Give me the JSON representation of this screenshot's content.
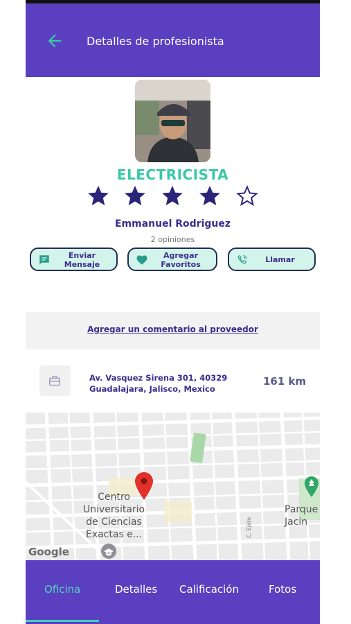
{
  "appbar": {
    "title": "Detalles de profesionista",
    "back_icon": "arrow-left-icon"
  },
  "profile": {
    "category": "ELECTRICISTA",
    "rating": 4,
    "max_rating": 5,
    "name": "Emmanuel Rodriguez",
    "opinions": "2 opiniones"
  },
  "actions": {
    "message": {
      "line1": "Enviar",
      "line2": "Mensaje",
      "icon": "message-icon"
    },
    "favorite": {
      "line1": "Agregar",
      "line2": "Favoritos",
      "icon": "heart-icon"
    },
    "call": {
      "label": "Llamar",
      "icon": "phone-icon"
    }
  },
  "comment": {
    "link": "Agregar un comentario al proveedor"
  },
  "location": {
    "address_line1": "Av. Vasquez Sirena 301, 40329",
    "address_line2": "Guadalajara, Jalisco, Mexico",
    "distance": "161 km",
    "icon": "briefcase-icon"
  },
  "map": {
    "poi1_line1": "Centro",
    "poi1_line2": "Universitario",
    "poi1_line3": "de Ciencias",
    "poi1_line4": "Exactas e...",
    "poi2_line1": "Parque",
    "poi2_line2": "Jacin",
    "street": "C. Ejido",
    "logo": "Google"
  },
  "tabs": [
    {
      "label": "Oficina",
      "active": true
    },
    {
      "label": "Detalles",
      "active": false
    },
    {
      "label": "Calificación",
      "active": false
    },
    {
      "label": "Fotos",
      "active": false
    }
  ],
  "colors": {
    "primary": "#5a3fc0",
    "accent": "#39c8a6",
    "star": "#2b2579",
    "text_dark": "#3b2d8f"
  }
}
